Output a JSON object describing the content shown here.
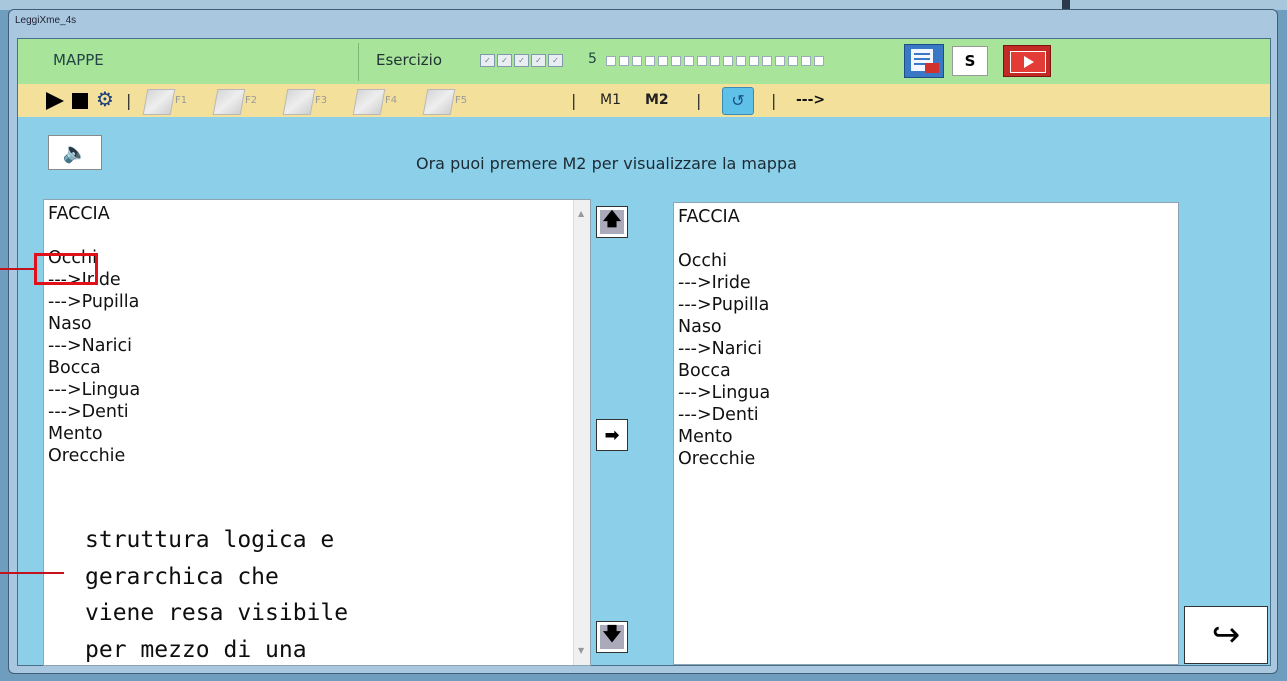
{
  "window": {
    "title": "LeggiXme_4s"
  },
  "header": {
    "section": "MAPPE",
    "exercise_label": "Esercizio",
    "exercise_number": "5",
    "checkbox_count": 5,
    "progress_squares": 17,
    "s_button": "S"
  },
  "toolbar": {
    "f_buttons": [
      "F1",
      "F2",
      "F3",
      "F4",
      "F5"
    ],
    "m1": "M1",
    "m2": "M2",
    "arrow": "--->",
    "separator": "|"
  },
  "instruction": "Ora puoi premere M2 per visualizzare la mappa",
  "left_list": {
    "lines": [
      "FACCIA",
      "",
      "Occhi",
      "--->Iride",
      "--->Pupilla",
      "Naso",
      "--->Narici",
      "Bocca",
      "--->Lingua",
      "--->Denti",
      "Mento",
      "Orecchie"
    ]
  },
  "right_list": {
    "lines": [
      "FACCIA",
      "",
      "Occhi",
      "--->Iride",
      "--->Pupilla",
      "Naso",
      "--->Narici",
      "Bocca",
      "--->Lingua",
      "--->Denti",
      "Mento",
      "Orecchie"
    ]
  },
  "annotation": {
    "lines": [
      "struttura logica e",
      "gerarchica che",
      "viene resa visibile",
      "per mezzo di una"
    ]
  },
  "colors": {
    "header_green": "#a8e59b",
    "toolbar_yellow": "#f3e09a",
    "client_blue": "#8ccfe9",
    "highlight_red": "#e0111b"
  },
  "icons": {
    "play": "play-icon",
    "stop": "stop-icon",
    "settings": "gear-icon",
    "speaker": "speaker-icon",
    "move_up": "arrow-up-icon",
    "transfer": "arrow-right-icon",
    "move_down": "arrow-down-icon",
    "redo": "redo-arrow-icon"
  }
}
